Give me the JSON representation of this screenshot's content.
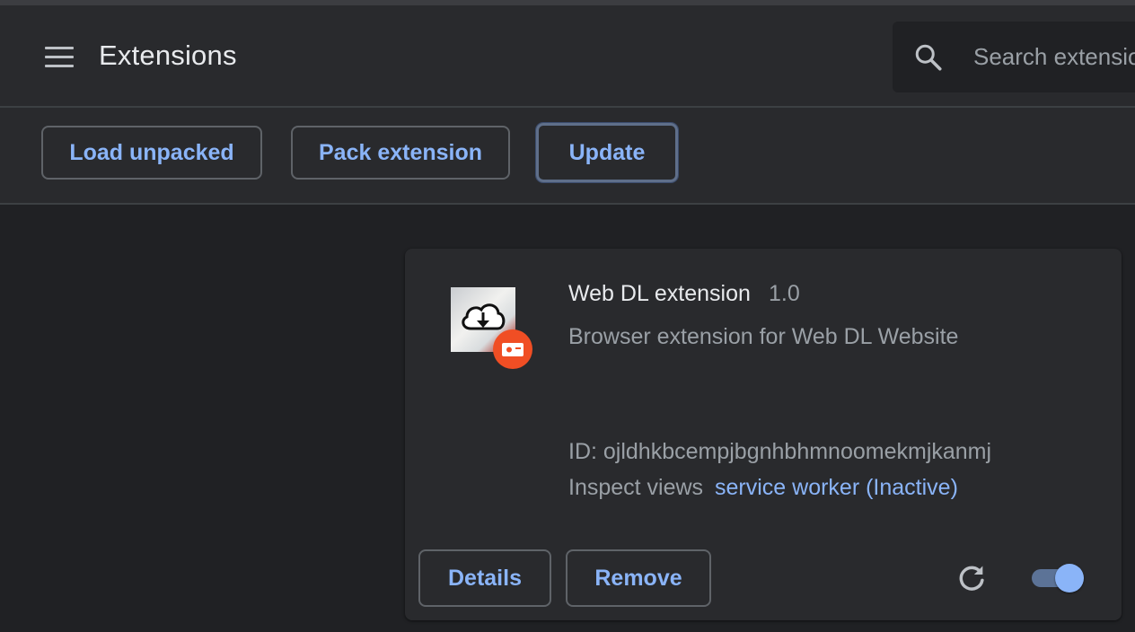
{
  "header": {
    "title": "Extensions",
    "menu_icon": "hamburger-menu-icon",
    "search": {
      "icon": "search-icon",
      "placeholder": "Search extensions"
    }
  },
  "toolbar": {
    "load_unpacked_label": "Load unpacked",
    "pack_extension_label": "Pack extension",
    "update_label": "Update"
  },
  "extension": {
    "name": "Web DL extension",
    "version": "1.0",
    "description": "Browser extension for Web DL Website",
    "id_text": "ID: ojldhkbcempjbgnhbhmnoomekmjkanmj",
    "inspect_label": "Inspect views",
    "inspect_link": "service worker (Inactive)",
    "details_label": "Details",
    "remove_label": "Remove",
    "enabled": true,
    "icon": "cloud-download-icon",
    "badge_icon": "unpacked-badge-icon",
    "reload_icon": "reload-icon"
  },
  "colors": {
    "background": "#202124",
    "surface": "#292a2d",
    "accent": "#8ab4f8",
    "text_primary": "#e8eaed",
    "text_secondary": "#9aa0a6",
    "badge": "#f04e24"
  }
}
